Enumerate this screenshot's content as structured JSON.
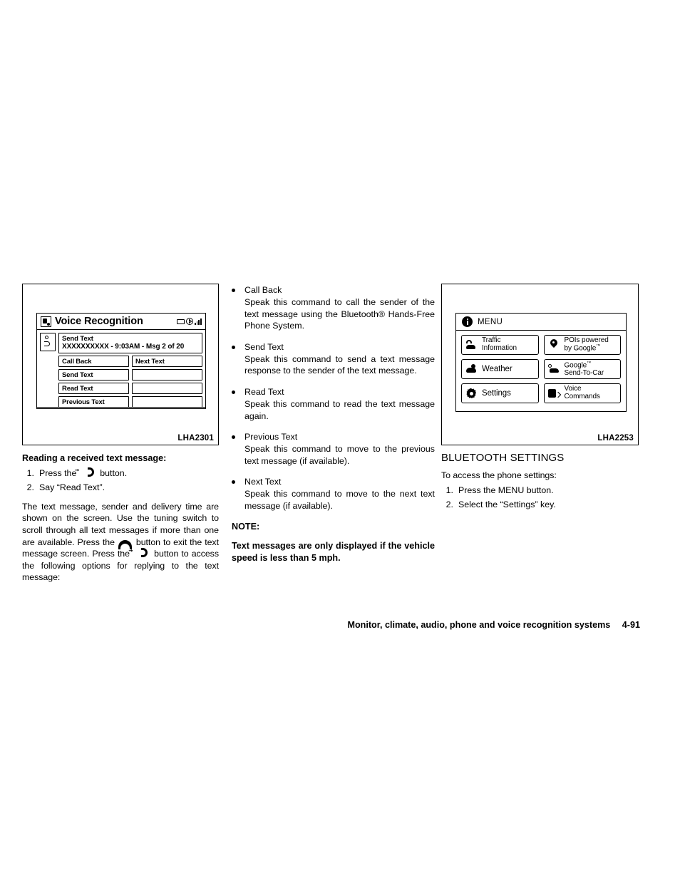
{
  "figure_left": {
    "code": "LHA2301",
    "screen": {
      "title": "Voice Recognition",
      "title_icon": "voice-recognition-icon",
      "status_icons": [
        "battery-icon",
        "bluetooth-icon",
        "signal-strength-icon"
      ],
      "message_icon": "text-message-icon",
      "message_line1": "Send Text",
      "message_line2": "XXXXXXXXXX  -  9:03AM  -  Msg 2 of 20",
      "keys_left": [
        "Call Back",
        "Send Text",
        "Read Text",
        "Previous Text"
      ],
      "keys_right": [
        "Next Text",
        "",
        "",
        ""
      ]
    }
  },
  "figure_right": {
    "code": "LHA2253",
    "screen": {
      "title": "MENU",
      "title_icon": "info-icon",
      "keys": [
        {
          "icon": "traffic-icon",
          "label_line1": "Traffic",
          "label_line2": "Information"
        },
        {
          "icon": "map-pin-icon",
          "label_line1": "POIs powered",
          "label_line2": "by Google",
          "tm": "™"
        },
        {
          "icon": "weather-icon",
          "label_line1": "Weather",
          "label_line2": ""
        },
        {
          "icon": "send-to-car-icon",
          "label_line1": "Google",
          "label_line2": "Send-To-Car",
          "tm": "™"
        },
        {
          "icon": "gear-icon",
          "label_line1": "Settings",
          "label_line2": ""
        },
        {
          "icon": "voice-commands-icon",
          "label_line1": "Voice",
          "label_line2": "Commands"
        }
      ]
    }
  },
  "col1": {
    "heading": "Reading a received text message:",
    "steps": [
      {
        "num": "1.",
        "pre": "Press the",
        "glyph": "talk-button-icon",
        "post": "button."
      },
      {
        "num": "2.",
        "pre": "Say “Read Text”.",
        "glyph": "",
        "post": ""
      }
    ],
    "paragraph_part1": "The text message, sender and delivery time are shown on the screen. Use the tuning switch to scroll through all text messages if more than one are available. Press the",
    "paragraph_part2": "button to exit the text message screen. Press the",
    "paragraph_part3": "button to access the following options for replying to the text message:"
  },
  "col2": {
    "bullets": [
      {
        "title": "Call Back",
        "desc": "Speak this command to call the sender of the text message using the Bluetooth® Hands-Free Phone System."
      },
      {
        "title": "Send Text",
        "desc": "Speak this command to send a text message response to the sender of the text message."
      },
      {
        "title": "Read Text",
        "desc": "Speak this command to read the text message again."
      },
      {
        "title": "Previous Text",
        "desc": "Speak this command to move to the previous text message (if available)."
      },
      {
        "title": "Next Text",
        "desc": "Speak this command to move to the next text message (if available)."
      }
    ],
    "note_label": "NOTE:",
    "note_text": "Text messages are only displayed if the vehicle speed is less than 5 mph."
  },
  "col3": {
    "section_title": "BLUETOOTH SETTINGS",
    "intro": "To access the phone settings:",
    "steps": [
      {
        "num": "1.",
        "text": "Press the MENU button."
      },
      {
        "num": "2.",
        "text": "Select the “Settings” key."
      }
    ]
  },
  "footer": {
    "chapter": "Monitor, climate, audio, phone and voice recognition systems",
    "page": "4-91"
  }
}
